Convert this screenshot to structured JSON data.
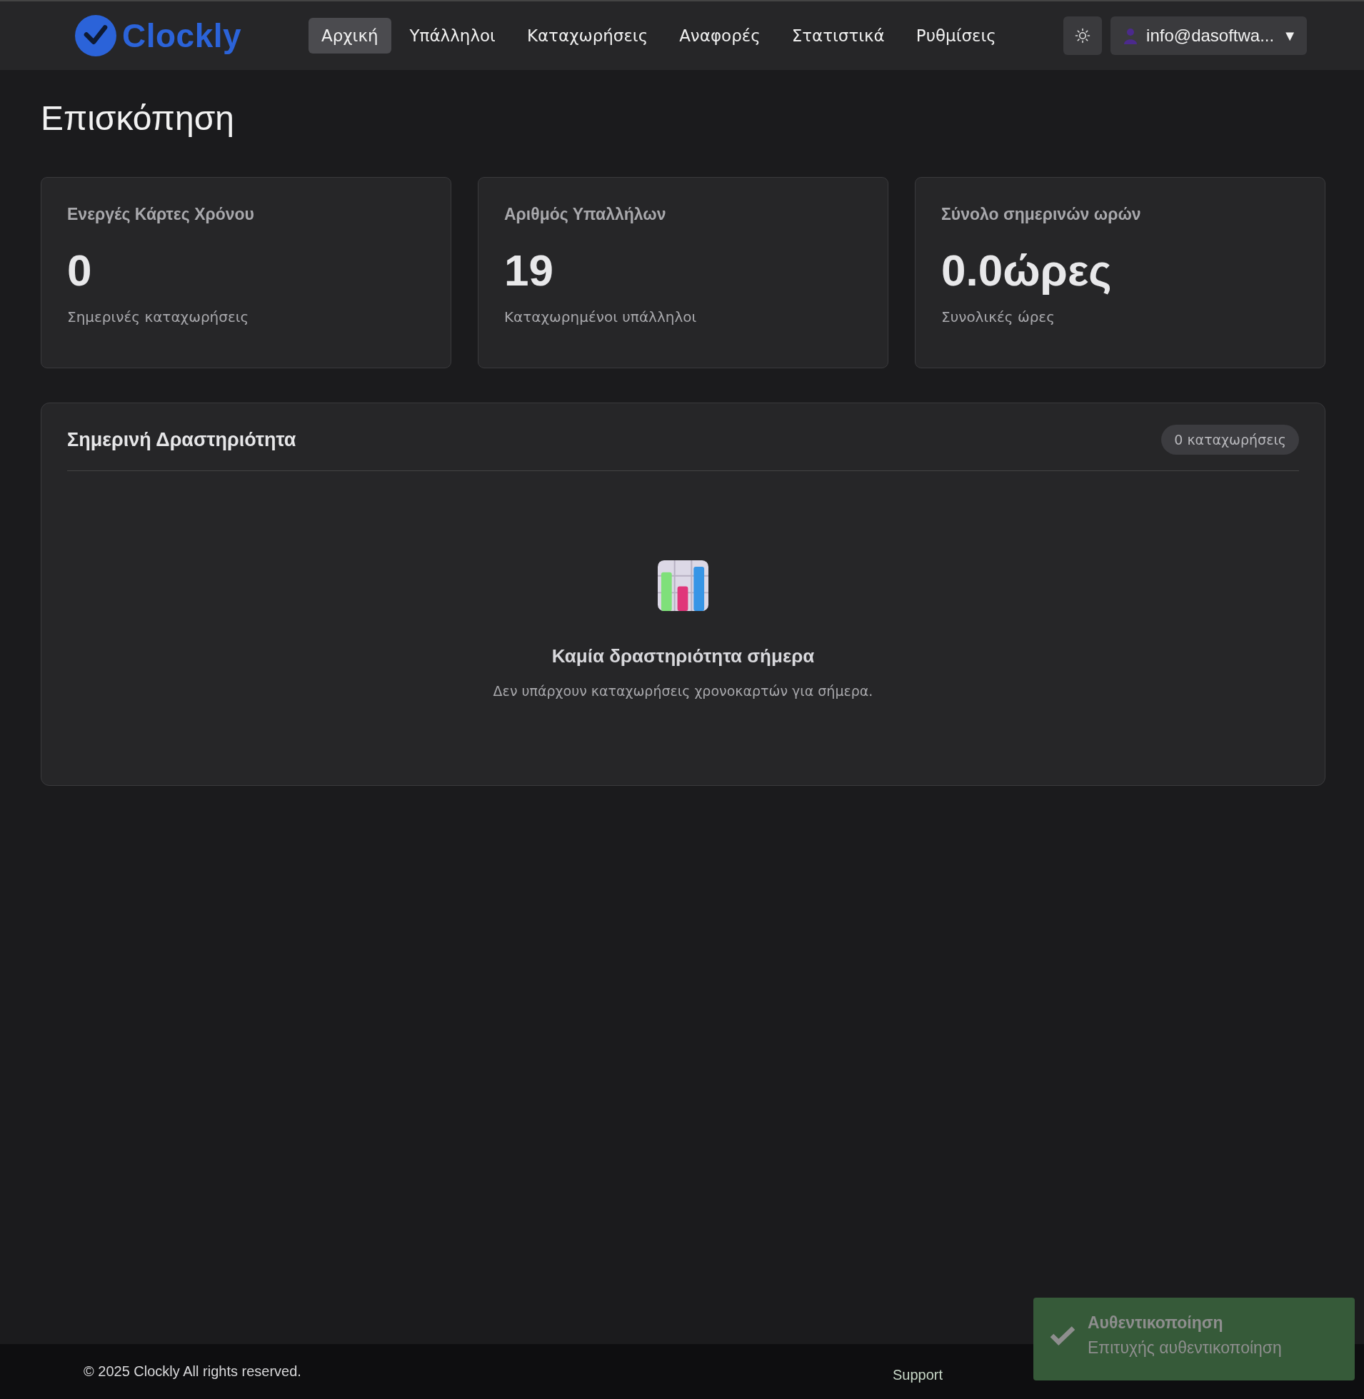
{
  "brand": {
    "name": "Clockly"
  },
  "nav": [
    {
      "label": "Αρχική",
      "selected": true
    },
    {
      "label": "Υπάλληλοι",
      "selected": false
    },
    {
      "label": "Καταχωρήσεις",
      "selected": false
    },
    {
      "label": "Αναφορές",
      "selected": false
    },
    {
      "label": "Στατιστικά",
      "selected": false
    },
    {
      "label": "Ρυθμίσεις",
      "selected": false
    }
  ],
  "user_menu": {
    "label": "info@dasoftwa...",
    "caret": "▼"
  },
  "page_title": "Επισκόπηση",
  "stats": [
    {
      "title": "Ενεργές Κάρτες Χρόνου",
      "value": "0",
      "caption": "Σημερινές καταχωρήσεις"
    },
    {
      "title": "Αριθμός Υπαλλήλων",
      "value": "19",
      "caption": "Καταχωρημένοι υπάλληλοι"
    },
    {
      "title": "Σύνολο σημερινών ωρών",
      "value": "0.0ώρες",
      "caption": "Συνολικές ώρες"
    }
  ],
  "activity": {
    "title": "Σημερινή Δραστηριότητα",
    "badge": "0 καταχωρήσεις",
    "empty_title": "Καμία δραστηριότητα σήμερα",
    "empty_text": "Δεν υπάρχουν καταχωρήσεις χρονοκαρτών για σήμερα."
  },
  "footer": {
    "copyright": "© 2025 Clockly All rights reserved.",
    "link": "Support"
  },
  "toast": {
    "kind": "success",
    "title": "Αυθεντικοποίηση",
    "message": "Επιτυχής αυθεντικοποίηση"
  }
}
